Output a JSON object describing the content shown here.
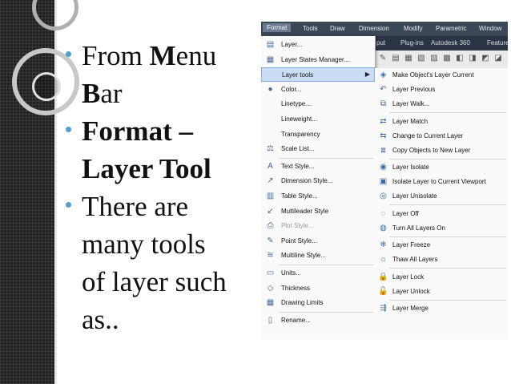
{
  "bullets": [
    {
      "lines": [
        {
          "parts": [
            {
              "t": "From ",
              "b": false
            },
            {
              "t": "M",
              "b": true
            },
            {
              "t": "enu",
              "b": false
            }
          ]
        },
        {
          "parts": [
            {
              "t": "B",
              "b": true
            },
            {
              "t": "ar",
              "b": false
            }
          ]
        }
      ]
    },
    {
      "lines": [
        {
          "parts": [
            {
              "t": "Format –",
              "b": true
            }
          ]
        },
        {
          "parts": [
            {
              "t": "Layer Tool",
              "b": true
            }
          ]
        }
      ]
    },
    {
      "lines": [
        {
          "parts": [
            {
              "t": "There are",
              "b": false
            }
          ]
        },
        {
          "parts": [
            {
              "t": "many tools",
              "b": false
            }
          ]
        },
        {
          "parts": [
            {
              "t": "of layer such",
              "b": false
            }
          ]
        },
        {
          "parts": [
            {
              "t": "as..",
              "b": false
            }
          ]
        }
      ]
    }
  ],
  "menubar": [
    "Format",
    "Tools",
    "Draw",
    "Dimension",
    "Modify",
    "Parametric",
    "Window"
  ],
  "ribbon_tabs": [
    "put",
    "Plug-ins",
    "Autodesk 360",
    "Featured"
  ],
  "format_menu": [
    {
      "label": "Layer...",
      "icon": "layer-icon",
      "glyph": "▤"
    },
    {
      "label": "Layer States Manager...",
      "icon": "layer-states-icon",
      "glyph": "▦"
    },
    {
      "label": "Layer tools",
      "icon": "",
      "glyph": "",
      "highlighted": true,
      "submenu": true
    },
    {
      "label": "Color...",
      "icon": "color-wheel-icon",
      "glyph": "●"
    },
    {
      "label": "Linetype...",
      "icon": "",
      "glyph": ""
    },
    {
      "label": "Lineweight...",
      "icon": "",
      "glyph": ""
    },
    {
      "label": "Transparency",
      "icon": "",
      "glyph": ""
    },
    {
      "label": "Scale List...",
      "icon": "scale-list-icon",
      "glyph": "⚖"
    },
    {
      "label": "Text Style...",
      "icon": "text-style-icon",
      "glyph": "A",
      "sep_before": true
    },
    {
      "label": "Dimension Style...",
      "icon": "dimension-style-icon",
      "glyph": "↗"
    },
    {
      "label": "Table Style...",
      "icon": "table-style-icon",
      "glyph": "▥"
    },
    {
      "label": "Multileader Style",
      "icon": "multileader-style-icon",
      "glyph": "↙"
    },
    {
      "label": "Plot Style...",
      "icon": "plot-style-icon",
      "glyph": "⎙",
      "disabled": true
    },
    {
      "label": "Point Style...",
      "icon": "point-style-icon",
      "glyph": "✎"
    },
    {
      "label": "Multiline Style...",
      "icon": "multiline-style-icon",
      "glyph": "≋"
    },
    {
      "label": "Units...",
      "icon": "units-icon",
      "glyph": "▭",
      "sep_before": true
    },
    {
      "label": "Thickness",
      "icon": "thickness-icon",
      "glyph": "◇"
    },
    {
      "label": "Drawing Limits",
      "icon": "drawing-limits-icon",
      "glyph": "▦"
    },
    {
      "label": "Rename...",
      "icon": "rename-icon",
      "glyph": "▯",
      "sep_before": true
    }
  ],
  "layer_tools_submenu": [
    {
      "label": "Make Object's Layer Current",
      "icon": "make-current-icon",
      "glyph": "◈"
    },
    {
      "label": "Layer Previous",
      "icon": "layer-previous-icon",
      "glyph": "↶"
    },
    {
      "label": "Layer Walk...",
      "icon": "layer-walk-icon",
      "glyph": "⧉"
    },
    {
      "label": "Layer Match",
      "icon": "layer-match-icon",
      "glyph": "⇄",
      "sep_before": true
    },
    {
      "label": "Change to Current Layer",
      "icon": "change-layer-icon",
      "glyph": "⇆"
    },
    {
      "label": "Copy Objects to New Layer",
      "icon": "copy-objects-icon",
      "glyph": "⧈"
    },
    {
      "label": "Layer Isolate",
      "icon": "layer-isolate-icon",
      "glyph": "◉",
      "sep_before": true
    },
    {
      "label": "Isolate Layer to Current Viewport",
      "icon": "isolate-viewport-icon",
      "glyph": "▣"
    },
    {
      "label": "Layer Unisolate",
      "icon": "layer-unisolate-icon",
      "glyph": "◎"
    },
    {
      "label": "Layer Off",
      "icon": "layer-off-icon",
      "glyph": "◌",
      "sep_before": true
    },
    {
      "label": "Turn All Layers On",
      "icon": "layers-on-icon",
      "glyph": "◍"
    },
    {
      "label": "Layer Freeze",
      "icon": "layer-freeze-icon",
      "glyph": "❄",
      "sep_before": true
    },
    {
      "label": "Thaw All Layers",
      "icon": "thaw-layers-icon",
      "glyph": "☼"
    },
    {
      "label": "Layer Lock",
      "icon": "layer-lock-icon",
      "glyph": "🔒",
      "sep_before": true
    },
    {
      "label": "Layer Unlock",
      "icon": "layer-unlock-icon",
      "glyph": "🔓"
    },
    {
      "label": "Layer Merge",
      "icon": "layer-merge-icon",
      "glyph": "⇶",
      "sep_before": true
    }
  ],
  "colors": {
    "bullet": "#4f9fcf",
    "menubar": "#3b4757",
    "highlight": "#c9ddf4"
  }
}
